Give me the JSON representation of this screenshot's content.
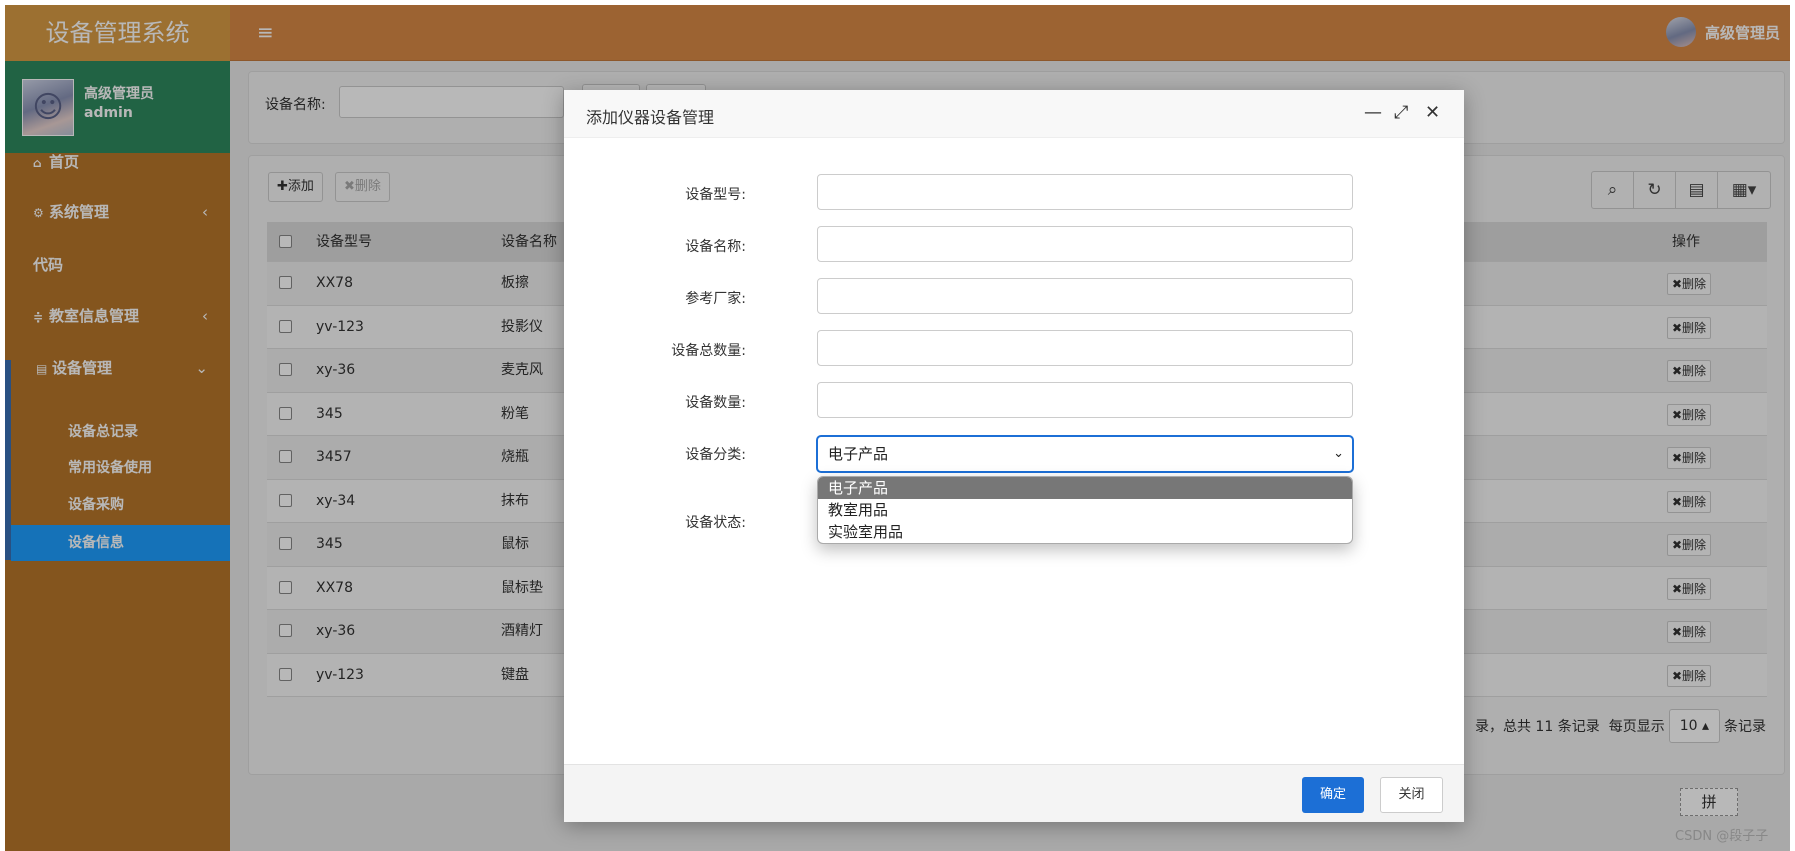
{
  "app": {
    "title": "设备管理系统"
  },
  "header": {
    "menu_icon": "≡",
    "user_name": "高级管理员"
  },
  "sidebar": {
    "user_name": "高级管理员",
    "user_login": "admin",
    "items": [
      {
        "label": "首页",
        "icon": "home-icon"
      },
      {
        "label": "系统管理",
        "icon": "gear-icon"
      },
      {
        "label": "代码",
        "icon": ""
      },
      {
        "label": "教室信息管理",
        "icon": "sliders-icon"
      },
      {
        "label": "设备管理",
        "icon": "server-icon"
      }
    ],
    "sub_items": [
      "设备总记录",
      "常用设备使用",
      "设备采购",
      "设备信息"
    ],
    "active_sub": "设备信息"
  },
  "search": {
    "label": "设备名称:"
  },
  "toolbar": {
    "add_label": "✚添加",
    "delete_label": "✖删除"
  },
  "table": {
    "headers": [
      "设备型号",
      "设备名称",
      "操作"
    ],
    "rows": [
      {
        "model": "XX78",
        "name": "板擦",
        "action": "✖删除"
      },
      {
        "model": "yv-123",
        "name": "投影仪",
        "action": "✖删除"
      },
      {
        "model": "xy-36",
        "name": "麦克风",
        "action": "✖删除"
      },
      {
        "model": "345",
        "name": "粉笔",
        "action": "✖删除"
      },
      {
        "model": "3457",
        "name": "烧瓶",
        "action": "✖删除"
      },
      {
        "model": "xy-34",
        "name": "抹布",
        "action": "✖删除"
      },
      {
        "model": "345",
        "name": "鼠标",
        "action": "✖删除"
      },
      {
        "model": "XX78",
        "name": "鼠标垫",
        "action": "✖删除"
      },
      {
        "model": "xy-36",
        "name": "酒精灯",
        "action": "✖删除"
      },
      {
        "model": "yv-123",
        "name": "键盘",
        "action": "✖删除"
      }
    ]
  },
  "pager": {
    "text_total": "录，总共 11 条记录",
    "text_per_page": "每页显示",
    "page_size": "10 ▴",
    "text_suffix": "条记录"
  },
  "ime": {
    "label": "拼"
  },
  "watermark": "CSDN @段子子",
  "modal": {
    "title": "添加仪器设备管理",
    "fields": [
      {
        "label": "设备型号:",
        "value": ""
      },
      {
        "label": "设备名称:",
        "value": ""
      },
      {
        "label": "参考厂家:",
        "value": ""
      },
      {
        "label": "设备总数量:",
        "value": ""
      },
      {
        "label": "设备数量:",
        "value": ""
      }
    ],
    "category_label": "设备分类:",
    "category_value": "电子产品",
    "category_options": [
      "电子产品",
      "教室用品",
      "实验室用品"
    ],
    "status_label": "设备状态:",
    "ok_label": "确定",
    "close_label": "关闭"
  }
}
